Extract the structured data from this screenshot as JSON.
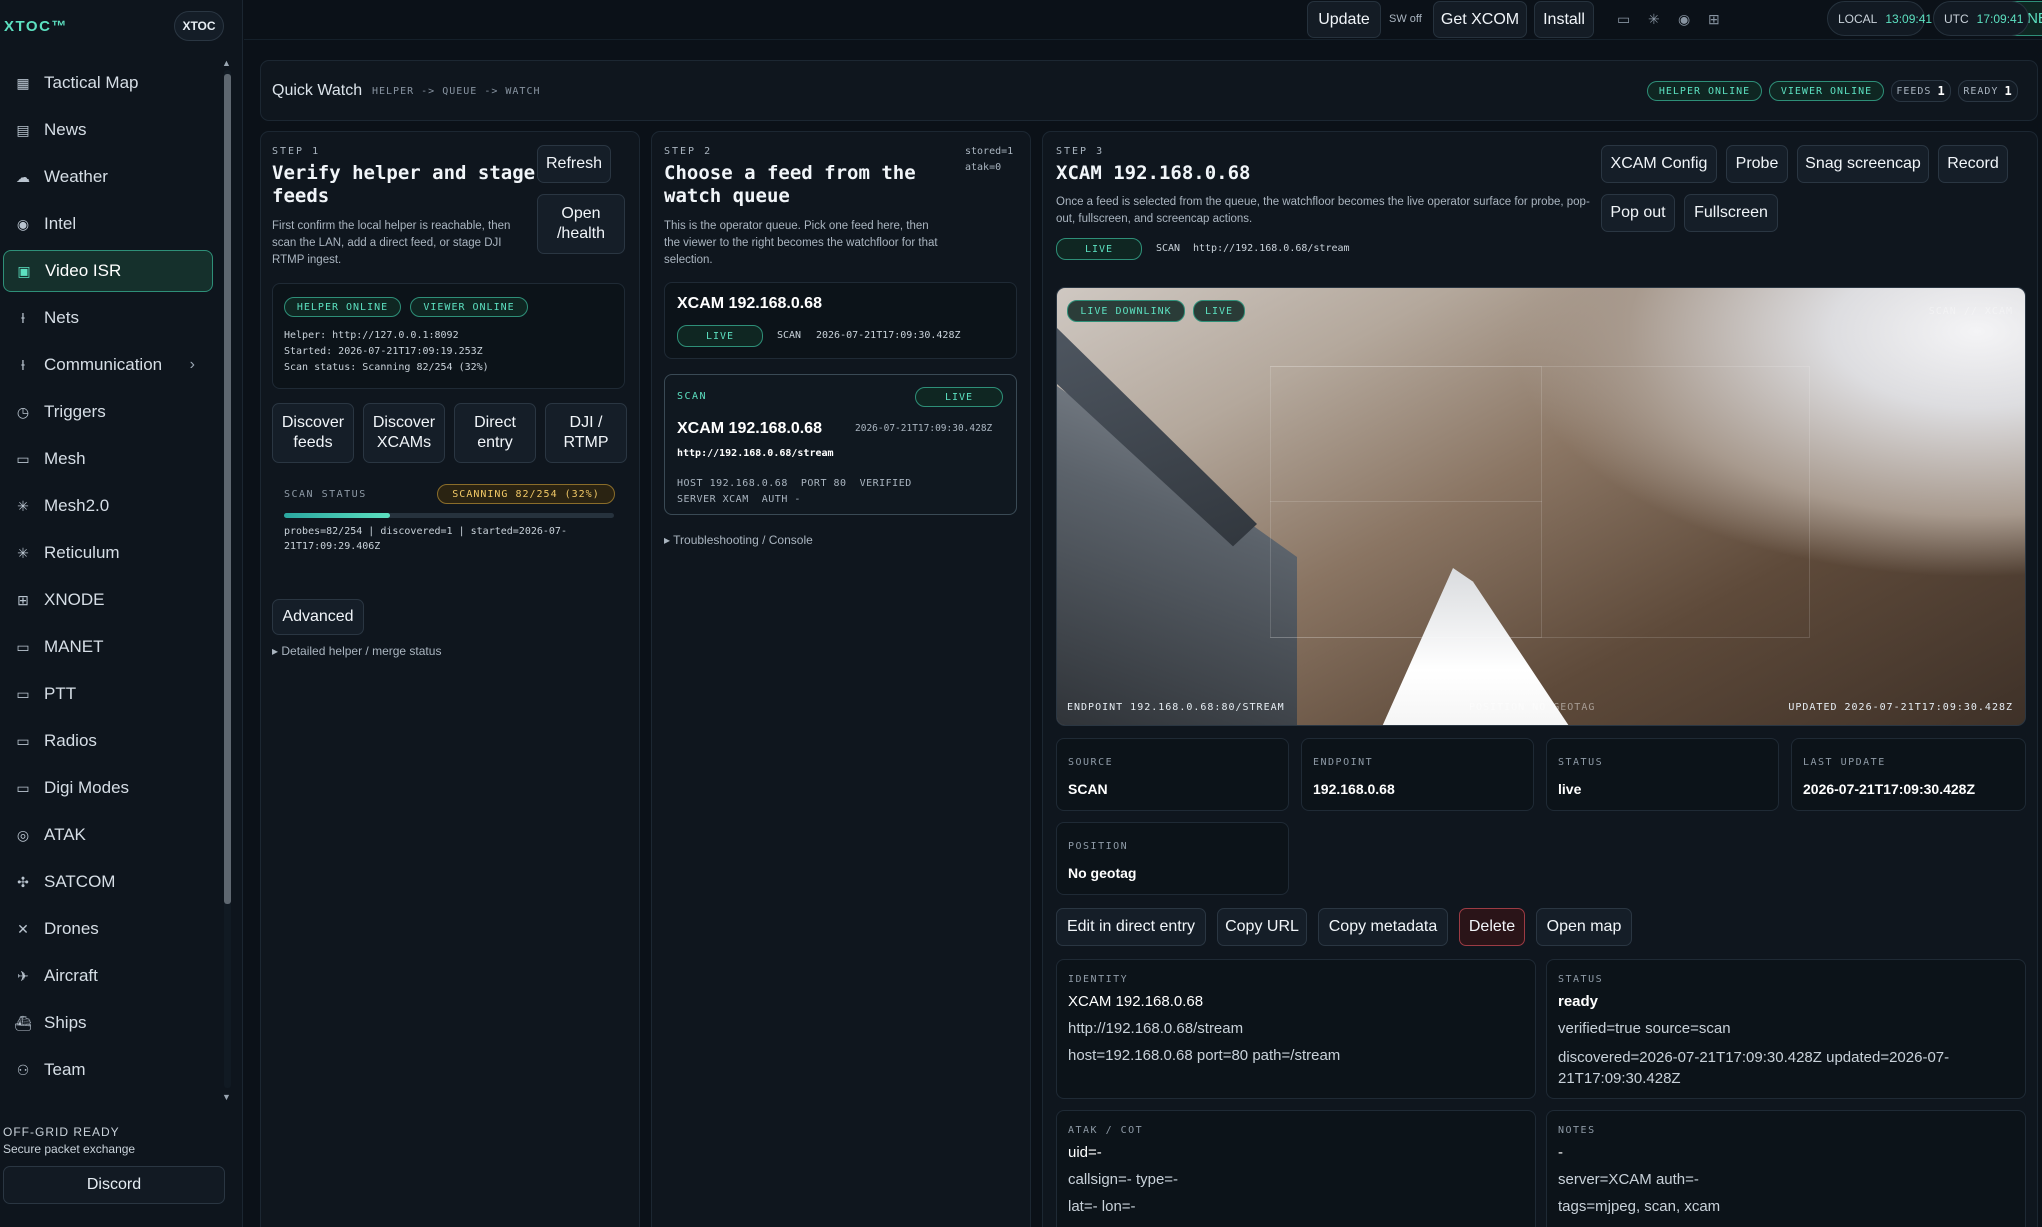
{
  "app": {
    "brand": "XTOC™",
    "brand_button": "XTOC"
  },
  "sidebar": {
    "items": [
      {
        "label": "Tactical Map",
        "icon": "map-icon"
      },
      {
        "label": "News",
        "icon": "newspaper-icon"
      },
      {
        "label": "Weather",
        "icon": "weather-icon"
      },
      {
        "label": "Intel",
        "icon": "eye-icon"
      },
      {
        "label": "Video ISR",
        "icon": "camera-icon",
        "active": true
      },
      {
        "label": "Nets",
        "icon": "antenna-icon"
      },
      {
        "label": "Communication",
        "icon": "antenna-icon",
        "has_children": true
      },
      {
        "label": "Triggers",
        "icon": "clock-icon"
      },
      {
        "label": "Mesh",
        "icon": "radio-icon"
      },
      {
        "label": "Mesh2.0",
        "icon": "asterisk-icon"
      },
      {
        "label": "Reticulum",
        "icon": "asterisk-icon"
      },
      {
        "label": "XNODE",
        "icon": "chip-icon"
      },
      {
        "label": "MANET",
        "icon": "radio-icon"
      },
      {
        "label": "PTT",
        "icon": "radio-icon"
      },
      {
        "label": "Radios",
        "icon": "radio-icon"
      },
      {
        "label": "Digi Modes",
        "icon": "radio-icon"
      },
      {
        "label": "ATAK",
        "icon": "target-icon"
      },
      {
        "label": "SATCOM",
        "icon": "satellite-icon"
      },
      {
        "label": "Drones",
        "icon": "drone-icon"
      },
      {
        "label": "Aircraft",
        "icon": "plane-icon"
      },
      {
        "label": "Ships",
        "icon": "ship-icon"
      },
      {
        "label": "Team",
        "icon": "users-icon"
      }
    ],
    "status_title": "OFF-GRID READY",
    "status_sub": "Secure packet exchange",
    "discord_label": "Discord"
  },
  "topbar": {
    "update": "Update",
    "sw": "SW off",
    "get_xcom": "Get XCOM",
    "install": "Install",
    "online": "ONLINE",
    "local_label": "LOCAL",
    "local_time": "13:09:41",
    "utc_label": "UTC",
    "utc_time": "17:09:41"
  },
  "quickwatch": {
    "title": "Quick Watch",
    "crumb": "HELPER -> QUEUE -> WATCH",
    "helper_pill": "HELPER ONLINE",
    "viewer_pill": "VIEWER ONLINE",
    "feeds_label": "FEEDS",
    "feeds_count": "1",
    "ready_label": "READY",
    "ready_count": "1"
  },
  "step1": {
    "step": "STEP 1",
    "heading": "Verify helper and stage feeds",
    "desc": "First confirm the local helper is reachable, then scan the LAN, add a direct feed, or stage DJI RTMP ingest.",
    "refresh": "Refresh",
    "open_health": "Open /health",
    "helper_pill": "HELPER ONLINE",
    "viewer_pill": "VIEWER ONLINE",
    "helper_line": "Helper: http://127.0.0.1:8092",
    "started_line": "Started: 2026-07-21T17:09:19.253Z",
    "scan_line": "Scan status: Scanning 82/254 (32%)",
    "btn_discover_feeds": "Discover feeds",
    "btn_discover_xcams": "Discover XCAMs",
    "btn_direct_entry": "Direct entry",
    "btn_dji_rtmp": "DJI / RTMP",
    "scan_status_label": "SCAN STATUS",
    "scan_badge": "SCANNING 82/254 (32%)",
    "scan_progress": 0.32,
    "scan_detail": "probes=82/254 | discovered=1 | started=2026-07-21T17:09:29.406Z",
    "advanced": "Advanced",
    "detail_toggle": "Detailed helper / merge status"
  },
  "step2": {
    "step": "STEP 2",
    "heading": "Choose a feed from the watch queue",
    "stored": "stored=1",
    "atak": "atak=0",
    "desc": "This is the operator queue. Pick one feed here, then the viewer to the right becomes the watchfloor for that selection.",
    "summary_title": "XCAM 192.168.0.68",
    "summary_live": "LIVE",
    "summary_source": "SCAN",
    "summary_time": "2026-07-21T17:09:30.428Z",
    "card_source": "SCAN",
    "card_live": "LIVE",
    "card_title": "XCAM 192.168.0.68",
    "card_time": "2026-07-21T17:09:30.428Z",
    "card_url": "http://192.168.0.68/stream",
    "card_meta1": "HOST 192.168.0.68  PORT 80  VERIFIED",
    "card_meta2": "SERVER XCAM  AUTH -",
    "troubleshoot": "Troubleshooting / Console"
  },
  "step3": {
    "step": "STEP 3",
    "heading": "XCAM 192.168.0.68",
    "desc": "Once a feed is selected from the queue, the watchfloor becomes the live operator surface for probe, pop-out, fullscreen, and screencap actions.",
    "live": "LIVE",
    "source": "SCAN",
    "url": "http://192.168.0.68/stream",
    "btn_config": "XCAM Config",
    "btn_probe": "Probe",
    "btn_snag": "Snag screencap",
    "btn_record": "Record",
    "btn_popout": "Pop out",
    "btn_fullscreen": "Fullscreen",
    "video": {
      "downlink_pill": "LIVE DOWNLINK",
      "live_pill": "LIVE",
      "corner": "SCAN // XCAM",
      "endpoint": "ENDPOINT 192.168.0.68:80/STREAM",
      "position": "POSITION NO GEOTAG",
      "updated": "UPDATED 2026-07-21T17:09:30.428Z"
    },
    "stats": {
      "source_label": "SOURCE",
      "source_value": "SCAN",
      "endpoint_label": "ENDPOINT",
      "endpoint_value": "192.168.0.68",
      "status_label": "STATUS",
      "status_value": "live",
      "update_label": "LAST UPDATE",
      "update_value": "2026-07-21T17:09:30.428Z",
      "position_label": "POSITION",
      "position_value": "No geotag"
    },
    "actions": {
      "edit": "Edit in direct entry",
      "copy_url": "Copy URL",
      "copy_meta": "Copy metadata",
      "delete": "Delete",
      "open_map": "Open map"
    },
    "identity": {
      "label": "IDENTITY",
      "name": "XCAM 192.168.0.68",
      "url": "http://192.168.0.68/stream",
      "host": "host=192.168.0.68 port=80 path=/stream"
    },
    "status": {
      "label": "STATUS",
      "value": "ready",
      "verified": "verified=true source=scan",
      "discovered": "discovered=2026-07-21T17:09:30.428Z updated=2026-07-21T17:09:30.428Z"
    },
    "atak": {
      "label": "ATAK / COT",
      "uid": "uid=-",
      "callsign": "callsign=- type=-",
      "latlon": "lat=- lon=-"
    },
    "notes": {
      "label": "NOTES",
      "value": "-",
      "server": "server=XCAM auth=-",
      "tags": "tags=mjpeg, scan, xcam"
    }
  }
}
